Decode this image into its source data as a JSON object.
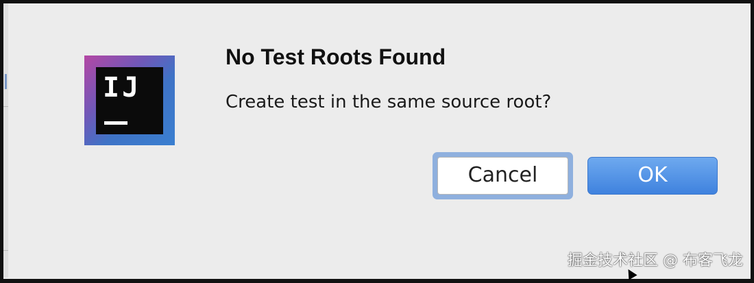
{
  "dialog": {
    "app_icon": {
      "name": "intellij-idea-icon",
      "letters": "IJ"
    },
    "title": "No Test Roots Found",
    "message": "Create test in the same source root?",
    "buttons": {
      "cancel_label": "Cancel",
      "ok_label": "OK"
    }
  },
  "watermark": "掘金技术社区 @ 布客飞龙",
  "colors": {
    "dialog_background": "#ececec",
    "ok_button": "#4a8de3",
    "focus_ring": "#8fb0de",
    "icon_gradient_start": "#b447a4",
    "icon_gradient_end": "#3a7fd0"
  }
}
